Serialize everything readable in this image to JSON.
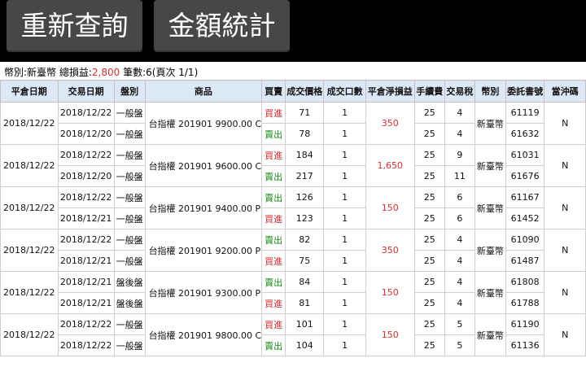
{
  "buttons": {
    "requery": "重新查詢",
    "stats": "金額統計"
  },
  "summary": {
    "prefix": "幣別:新臺幣 總損益:",
    "total": "2,800",
    "suffix": " 筆數:6(頁次 1/1)"
  },
  "headers": [
    "平倉日期",
    "交易日期",
    "盤別",
    "商品",
    "買賣",
    "成交價格",
    "成交口數",
    "平倉淨損益",
    "手續費",
    "交易稅",
    "幣別",
    "委託書號",
    "當沖碼"
  ],
  "groups": [
    {
      "close_date": "2018/12/22",
      "product": "台指權 201901 9900.00 C",
      "pl": "350",
      "currency": "新臺幣",
      "daytrade": "N",
      "rows": [
        {
          "trade_date": "2018/12/22",
          "session": "一般盤",
          "side": "買進",
          "side_type": "buy",
          "price": "71",
          "qty": "1",
          "fee": "25",
          "tax": "4",
          "order": "61119"
        },
        {
          "trade_date": "2018/12/20",
          "session": "一般盤",
          "side": "賣出",
          "side_type": "sell",
          "price": "78",
          "qty": "1",
          "fee": "25",
          "tax": "4",
          "order": "61632"
        }
      ]
    },
    {
      "close_date": "2018/12/22",
      "product": "台指權 201901 9600.00 C",
      "pl": "1,650",
      "currency": "新臺幣",
      "daytrade": "N",
      "rows": [
        {
          "trade_date": "2018/12/22",
          "session": "一般盤",
          "side": "買進",
          "side_type": "buy",
          "price": "184",
          "qty": "1",
          "fee": "25",
          "tax": "9",
          "order": "61031"
        },
        {
          "trade_date": "2018/12/20",
          "session": "一般盤",
          "side": "賣出",
          "side_type": "sell",
          "price": "217",
          "qty": "1",
          "fee": "25",
          "tax": "11",
          "order": "61676"
        }
      ]
    },
    {
      "close_date": "2018/12/22",
      "product": "台指權 201901 9400.00 P",
      "pl": "150",
      "currency": "新臺幣",
      "daytrade": "N",
      "rows": [
        {
          "trade_date": "2018/12/22",
          "session": "一般盤",
          "side": "賣出",
          "side_type": "sell",
          "price": "126",
          "qty": "1",
          "fee": "25",
          "tax": "6",
          "order": "61167"
        },
        {
          "trade_date": "2018/12/21",
          "session": "一般盤",
          "side": "買進",
          "side_type": "buy",
          "price": "123",
          "qty": "1",
          "fee": "25",
          "tax": "6",
          "order": "61452"
        }
      ]
    },
    {
      "close_date": "2018/12/22",
      "product": "台指權 201901 9200.00 P",
      "pl": "350",
      "currency": "新臺幣",
      "daytrade": "N",
      "rows": [
        {
          "trade_date": "2018/12/22",
          "session": "一般盤",
          "side": "賣出",
          "side_type": "sell",
          "price": "82",
          "qty": "1",
          "fee": "25",
          "tax": "4",
          "order": "61090"
        },
        {
          "trade_date": "2018/12/21",
          "session": "一般盤",
          "side": "買進",
          "side_type": "buy",
          "price": "75",
          "qty": "1",
          "fee": "25",
          "tax": "4",
          "order": "61487"
        }
      ]
    },
    {
      "close_date": "2018/12/22",
      "product": "台指權 201901 9300.00 P",
      "pl": "150",
      "currency": "新臺幣",
      "daytrade": "N",
      "rows": [
        {
          "trade_date": "2018/12/21",
          "session": "盤後盤",
          "side": "賣出",
          "side_type": "sell",
          "price": "84",
          "qty": "1",
          "fee": "25",
          "tax": "4",
          "order": "61808"
        },
        {
          "trade_date": "2018/12/21",
          "session": "盤後盤",
          "side": "買進",
          "side_type": "buy",
          "price": "81",
          "qty": "1",
          "fee": "25",
          "tax": "4",
          "order": "61788"
        }
      ]
    },
    {
      "close_date": "2018/12/22",
      "product": "台指權 201901 9800.00 C",
      "pl": "150",
      "currency": "新臺幣",
      "daytrade": "N",
      "rows": [
        {
          "trade_date": "2018/12/22",
          "session": "一般盤",
          "side": "買進",
          "side_type": "buy",
          "price": "101",
          "qty": "1",
          "fee": "25",
          "tax": "5",
          "order": "61190"
        },
        {
          "trade_date": "2018/12/22",
          "session": "一般盤",
          "side": "賣出",
          "side_type": "sell",
          "price": "104",
          "qty": "1",
          "fee": "25",
          "tax": "5",
          "order": "61136"
        }
      ]
    }
  ]
}
